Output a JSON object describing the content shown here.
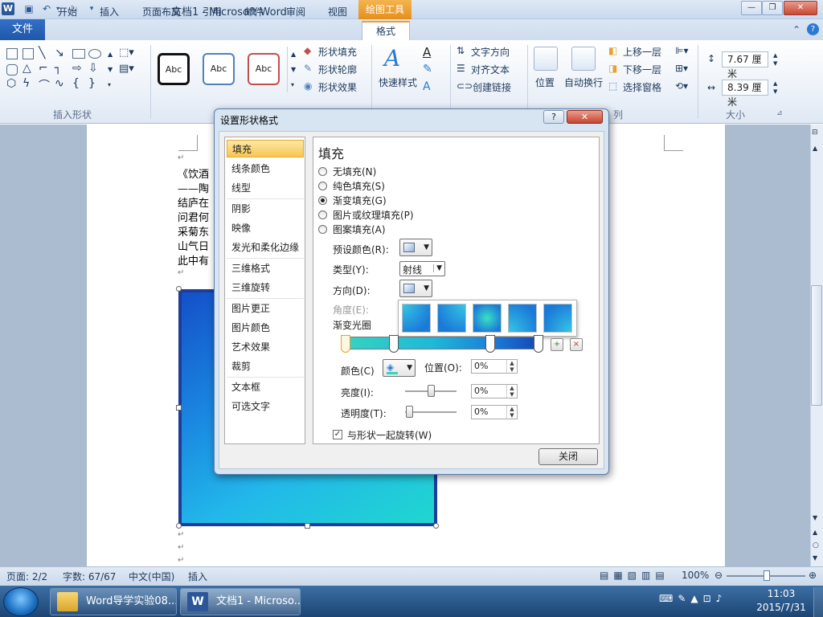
{
  "titlebar": {
    "doc_title": "文档1 - Microsoft Word",
    "context_tool": "绘图工具",
    "app_icon": "W",
    "minimize": "—",
    "restore": "❐",
    "close": "✕"
  },
  "tabs": {
    "file": "文件",
    "items": [
      "开始",
      "插入",
      "页面布局",
      "引用",
      "邮件",
      "审阅",
      "视图",
      "格式"
    ]
  },
  "ribbon": {
    "insert_shapes_label": "插入形状",
    "style_samples": [
      "Abc",
      "Abc",
      "Abc"
    ],
    "shape_fill": "形状填充",
    "shape_outline": "形状轮廓",
    "shape_effects": "形状效果",
    "quick_styles": "快速样式",
    "text_direction": "文字方向",
    "align_text": "对齐文本",
    "create_link": "创建链接",
    "position": "位置",
    "wrap_text": "自动换行",
    "bring_forward": "上移一层",
    "send_backward": "下移一层",
    "selection_pane": "选择窗格",
    "arrange_label_partial": "列",
    "height": "7.67 厘米",
    "width": "8.39 厘米",
    "size_label": "大小"
  },
  "document": {
    "lines": [
      "《饮酒",
      "——陶",
      "结庐在",
      "问君何",
      "采菊东",
      "山气日",
      "此中有"
    ]
  },
  "dialog": {
    "title": "设置形状格式",
    "help": "?",
    "close": "✕",
    "nav": [
      "填充",
      "线条颜色",
      "线型",
      "阴影",
      "映像",
      "发光和柔化边缘",
      "三维格式",
      "三维旋转",
      "图片更正",
      "图片颜色",
      "艺术效果",
      "裁剪",
      "文本框",
      "可选文字"
    ],
    "panel_title": "填充",
    "fill_options": [
      "无填充(N)",
      "纯色填充(S)",
      "渐变填充(G)",
      "图片或纹理填充(P)",
      "图案填充(A)"
    ],
    "selected_fill": 2,
    "preset_color_label": "预设颜色(R):",
    "type_label": "类型(Y):",
    "type_value": "射线",
    "direction_label": "方向(D):",
    "angle_label": "角度(E):",
    "gradient_stops_label": "渐变光圈",
    "color_label": "颜色(C)",
    "position_label": "位置(O):",
    "position_value": "0%",
    "brightness_label": "亮度(I):",
    "brightness_value": "0%",
    "transparency_label": "透明度(T):",
    "transparency_value": "0%",
    "rotate_with_shape": "与形状一起旋转(W)",
    "close_button": "关闭"
  },
  "statusbar": {
    "page": "页面: 2/2",
    "words": "字数: 67/67",
    "language": "中文(中国)",
    "mode": "插入",
    "zoom": "100%"
  },
  "taskbar": {
    "items": [
      "Word导学实验08...",
      "文档1 - Microso..."
    ],
    "time": "11:03",
    "date": "2015/7/31"
  },
  "colors": {
    "accent": "#2b579a",
    "context_tab": "#e58f1a",
    "shape_dark": "#1450c8",
    "shape_light": "#20d7cf"
  }
}
